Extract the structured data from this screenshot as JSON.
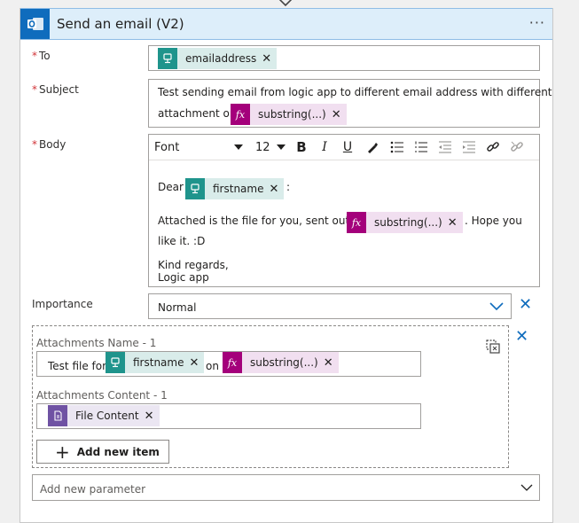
{
  "action": {
    "title": "Send an email (V2)",
    "menu_glyph": "···",
    "icon": "outlook-icon"
  },
  "to": {
    "label": "To",
    "required_mark": "*",
    "token": {
      "label": "emailaddress",
      "icon": "dynamic-content-icon"
    }
  },
  "subject": {
    "label": "Subject",
    "required_mark": "*",
    "line1": "Test sending email from logic app to different email address with different",
    "line2_prefix": "attachment on",
    "token": {
      "label": "substring(...)",
      "icon": "fx-icon",
      "icon_text": "fx"
    }
  },
  "body": {
    "label": "Body",
    "required_mark": "*",
    "toolbar": {
      "font": "Font",
      "size": "12",
      "bold": "B",
      "italic": "I",
      "underline": "U"
    },
    "greeting": "Dear",
    "greeting_token": {
      "label": "firstname",
      "icon": "dynamic-content-icon"
    },
    "greeting_suffix": ":",
    "para_prefix": "Attached is the file for you, sent out on",
    "para_token": {
      "label": "substring(...)",
      "icon": "fx-icon",
      "icon_text": "fx"
    },
    "para_suffix": ". Hope you",
    "para_line2": "like it. :D",
    "closing1": "Kind regards,",
    "closing2": "Logic app"
  },
  "importance": {
    "label": "Importance",
    "value": "Normal"
  },
  "attachments": {
    "name_label": "Attachments Name - 1",
    "name_prefix": "Test file for",
    "name_token1": {
      "label": "firstname",
      "icon": "dynamic-content-icon"
    },
    "name_middle": "on",
    "name_token2": {
      "label": "substring(...)",
      "icon": "fx-icon",
      "icon_text": "fx"
    },
    "content_label": "Attachments Content - 1",
    "content_token": {
      "label": "File Content",
      "icon": "file-icon"
    },
    "add_item_label": "Add new item"
  },
  "add_parameter": {
    "placeholder": "Add new parameter"
  },
  "colors": {
    "accent": "#0f6cbd",
    "required": "#d13438",
    "teal": "#1f948c",
    "fx": "#a4007b",
    "purple": "#6f52a3"
  }
}
